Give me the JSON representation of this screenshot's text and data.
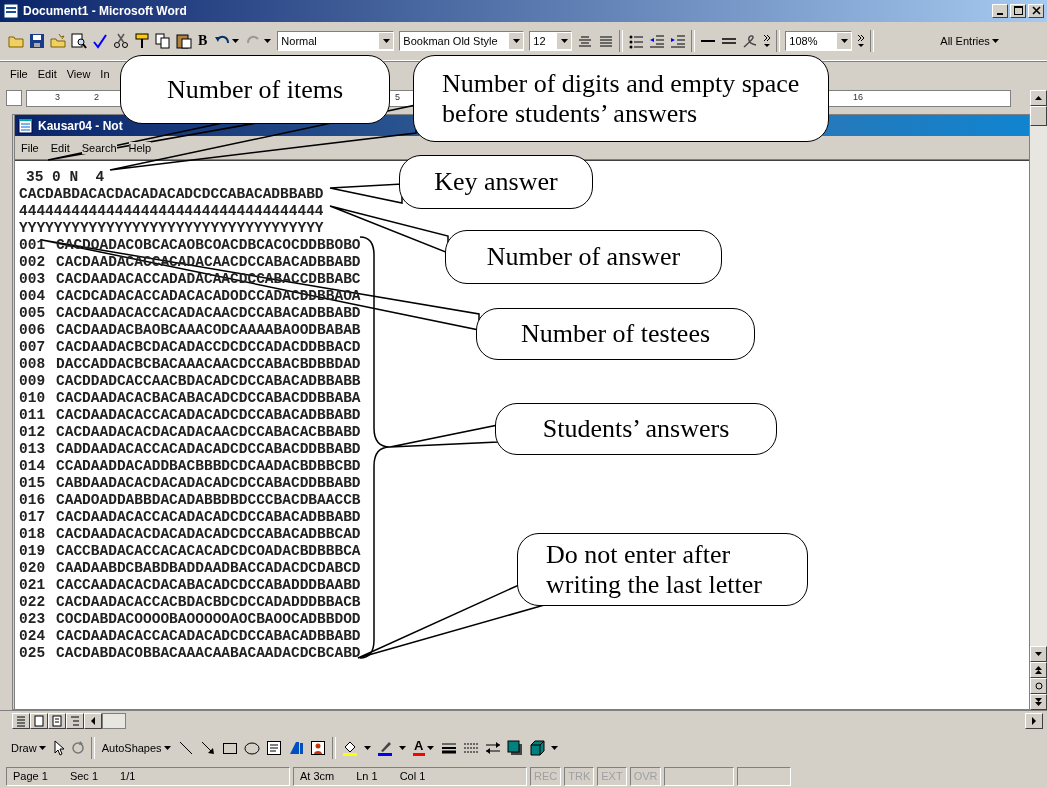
{
  "word_window": {
    "title": "Document1 - Microsoft Word",
    "toolbar": {
      "bold_glyph": "B",
      "style": "Normal",
      "font": "Bookman Old Style",
      "size": "12",
      "zoom": "108%",
      "entries": "All Entries"
    },
    "menu": [
      "File",
      "Edit",
      "View",
      "In"
    ],
    "ruler_labels": [
      "3",
      "2",
      "5",
      "16"
    ]
  },
  "notepad": {
    "title": "Kausar04 - Not",
    "menu": [
      "File",
      "Edit",
      "Search",
      "Help"
    ],
    "header": "35 0 N  4",
    "key": "CACDABDACACDACADACADCDCCABACADBBABD",
    "counts": "44444444444444444444444444444444444",
    "flags": "YYYYYYYYYYYYYYYYYYYYYYYYYYYYYYYYYYY",
    "rows": [
      {
        "number": "001",
        "answers": "CACDOADACOBCACAOBCOACDBCACOCDDBBOBO"
      },
      {
        "number": "002",
        "answers": "CACDAADACACCACADACAACDCCABACADBBABD"
      },
      {
        "number": "003",
        "answers": "CACDAADACACCADADACAACDCCABACCDBBABC"
      },
      {
        "number": "004",
        "answers": "CACDCADACACCADACACADODCCADACDDBBAOA"
      },
      {
        "number": "005",
        "answers": "CACDAADACACCACADACAACDCCABACADBBABD"
      },
      {
        "number": "006",
        "answers": "CACDAADACBAOBCAAACODCAAAABAOODBABAB"
      },
      {
        "number": "007",
        "answers": "CACDAADACBCDACADACCDCDCCADACDDBBACD"
      },
      {
        "number": "008",
        "answers": "DACCADDACBCBACAAACAACDCCABACBDBBDAD"
      },
      {
        "number": "009",
        "answers": "CACDDADCACCAACBDACADCDCCABACADBBABB"
      },
      {
        "number": "010",
        "answers": "CACDAADACACBACABACADCDCCABACDDBBABA"
      },
      {
        "number": "011",
        "answers": "CACDAADACACCACADACADCDCCABACADBBABD"
      },
      {
        "number": "012",
        "answers": "CACDAADACACDACADACAACDCCABACACBBABD"
      },
      {
        "number": "013",
        "answers": "CADDAADACACCACADACADCDCCABACDDBBABD"
      },
      {
        "number": "014",
        "answers": "CCADAADDACADDBACBBBDCDCAADACBDBBCBD"
      },
      {
        "number": "015",
        "answers": "CABDAADACACDACADACADCDCCABACDDBBABD"
      },
      {
        "number": "016",
        "answers": "CAADOADDABBDACADABBDBDCCCBACDBAACCB"
      },
      {
        "number": "017",
        "answers": "CACDAADACACCACADACADCDCCABACADBBABD"
      },
      {
        "number": "018",
        "answers": "CACDAADACACDACADACADCDCCABACADBBCAD"
      },
      {
        "number": "019",
        "answers": "CACCBADACACCACACACADCDCOADACBDBBBCA"
      },
      {
        "number": "020",
        "answers": "CAADAABDCBABDBADDAADBACCADACDCDABCD"
      },
      {
        "number": "021",
        "answers": "CACCAADACACDACABACADCDCCABADDDBAABD"
      },
      {
        "number": "022",
        "answers": "CACDAADACACCACBDACBDCDCCADADDDBBACB"
      },
      {
        "number": "023",
        "answers": "COCDABDACOOOOBAOOOOOAOCBAOOCADBBDOD"
      },
      {
        "number": "024",
        "answers": "CACDAADACACCACADACADCDCCABACADBBABD"
      },
      {
        "number": "025",
        "answers": "CACDABDACOBBACAAACAABACAADACDCBCABD"
      }
    ]
  },
  "drawing_toolbar": {
    "draw": "Draw",
    "autoshapes": "AutoShapes",
    "font_color_glyph": "A"
  },
  "status_bar": [
    {
      "text": "Page 1",
      "disabled": false
    },
    {
      "text": "Sec 1",
      "disabled": false
    },
    {
      "text": "1/1",
      "disabled": false
    },
    {
      "text": "At 3cm",
      "disabled": false
    },
    {
      "text": "Ln 1",
      "disabled": false
    },
    {
      "text": "Col 1",
      "disabled": false
    },
    {
      "text": "REC",
      "disabled": true
    },
    {
      "text": "TRK",
      "disabled": true
    },
    {
      "text": "EXT",
      "disabled": true
    },
    {
      "text": "OVR",
      "disabled": true
    }
  ],
  "callouts": [
    {
      "text": "Number of items"
    },
    {
      "text": "Number of digits and empty space before students’ answers"
    },
    {
      "text": "Key answer"
    },
    {
      "text": "Number of answer"
    },
    {
      "text": "Number of testees"
    },
    {
      "text": "Students’ answers"
    },
    {
      "text": "Do not enter after writing the last letter"
    }
  ]
}
